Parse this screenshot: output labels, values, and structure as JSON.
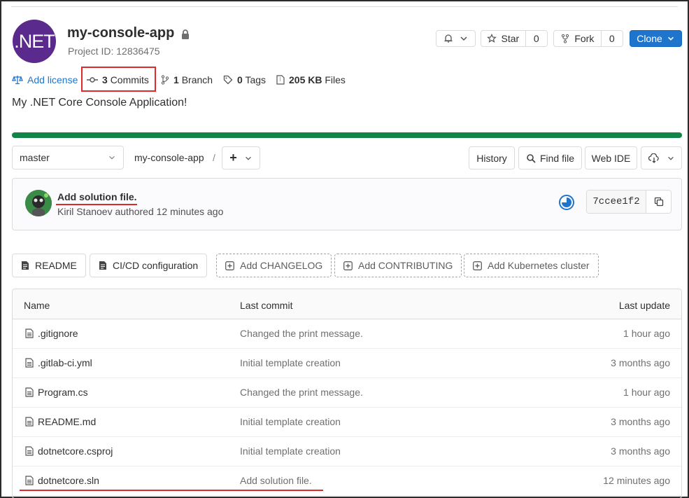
{
  "project": {
    "avatar_text": ".NET",
    "name": "my-console-app",
    "id_text": "Project ID: 12836475",
    "description": "My .NET Core Console Application!"
  },
  "header_actions": {
    "star_label": "Star",
    "star_count": "0",
    "fork_label": "Fork",
    "fork_count": "0",
    "clone_label": "Clone"
  },
  "stats": {
    "add_license": "Add license",
    "commits_count": "3",
    "commits_label": "Commits",
    "branch_count": "1",
    "branch_label": "Branch",
    "tags_count": "0",
    "tags_label": "Tags",
    "files_size": "205 KB",
    "files_label": "Files"
  },
  "pipeline": {
    "status_color": "#108548",
    "progress": 1.0
  },
  "repo_nav": {
    "branch": "master",
    "breadcrumb": "my-console-app",
    "separator": "/",
    "add_label": "+",
    "history": "History",
    "find_file": "Find file",
    "web_ide": "Web IDE"
  },
  "last_commit": {
    "title": "Add solution file.",
    "author_meta": "Kiril Stanoev authored 12 minutes ago",
    "sha": "7ccee1f2"
  },
  "template_buttons": {
    "readme": "README",
    "cicd": "CI/CD configuration",
    "changelog": "Add CHANGELOG",
    "contributing": "Add CONTRIBUTING",
    "kubernetes": "Add Kubernetes cluster"
  },
  "file_table": {
    "headers": {
      "name": "Name",
      "last_commit": "Last commit",
      "last_update": "Last update"
    },
    "rows": [
      {
        "name": ".gitignore",
        "commit": "Changed the print message.",
        "updated": "1 hour ago"
      },
      {
        "name": ".gitlab-ci.yml",
        "commit": "Initial template creation",
        "updated": "3 months ago"
      },
      {
        "name": "Program.cs",
        "commit": "Changed the print message.",
        "updated": "1 hour ago"
      },
      {
        "name": "README.md",
        "commit": "Initial template creation",
        "updated": "3 months ago"
      },
      {
        "name": "dotnetcore.csproj",
        "commit": "Initial template creation",
        "updated": "3 months ago"
      },
      {
        "name": "dotnetcore.sln",
        "commit": "Add solution file.",
        "updated": "12 minutes ago"
      }
    ]
  },
  "colors": {
    "accent": "#1f75cb",
    "highlight": "#dd2b2b",
    "net_brand": "#5a2a8c"
  }
}
